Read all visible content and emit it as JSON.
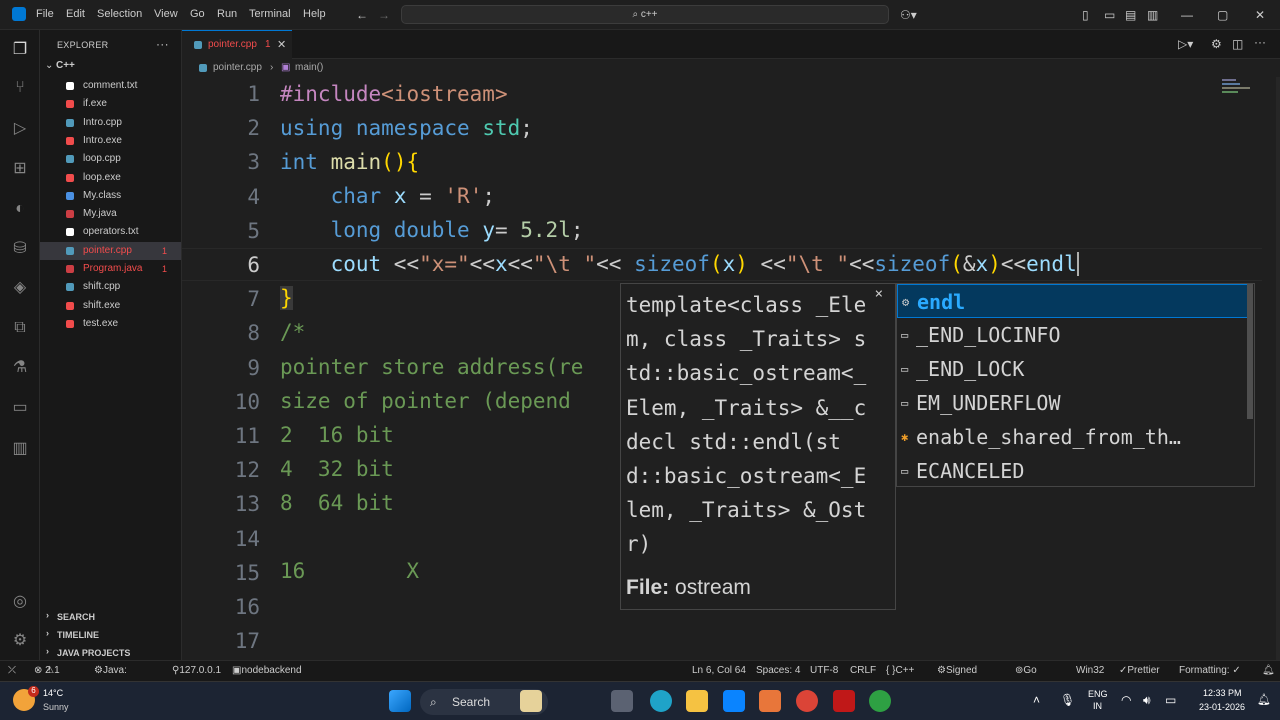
{
  "menu": [
    "File",
    "Edit",
    "Selection",
    "View",
    "Go",
    "Run",
    "Terminal",
    "Help"
  ],
  "search_placeholder": "c++",
  "sidebar": {
    "title": "EXPLORER",
    "folder": "C++",
    "files": [
      {
        "name": "comment.txt",
        "color": "#ffffff",
        "badge": ""
      },
      {
        "name": "if.exe",
        "color": "#f14c4c",
        "badge": ""
      },
      {
        "name": "Intro.cpp",
        "color": "#519aba",
        "badge": ""
      },
      {
        "name": "Intro.exe",
        "color": "#f14c4c",
        "badge": ""
      },
      {
        "name": "loop.cpp",
        "color": "#519aba",
        "badge": ""
      },
      {
        "name": "loop.exe",
        "color": "#f14c4c",
        "badge": ""
      },
      {
        "name": "My.class",
        "color": "#4a90e2",
        "badge": ""
      },
      {
        "name": "My.java",
        "color": "#cc3e44",
        "badge": ""
      },
      {
        "name": "operators.txt",
        "color": "#ffffff",
        "badge": ""
      },
      {
        "name": "pointer.cpp",
        "color": "#519aba",
        "badge": "1"
      },
      {
        "name": "Program.java",
        "color": "#cc3e44",
        "badge": "1"
      },
      {
        "name": "shift.cpp",
        "color": "#519aba",
        "badge": ""
      },
      {
        "name": "shift.exe",
        "color": "#f14c4c",
        "badge": ""
      },
      {
        "name": "test.exe",
        "color": "#f14c4c",
        "badge": ""
      }
    ],
    "sections": [
      "SEARCH",
      "TIMELINE",
      "JAVA PROJECTS"
    ]
  },
  "tab": {
    "label": "pointer.cpp",
    "badge": "1"
  },
  "breadcrumb": {
    "file": "pointer.cpp",
    "symbol": "main()"
  },
  "line_numbers": [
    "1",
    "2",
    "3",
    "4",
    "5",
    "6",
    "7",
    "8",
    "9",
    "10",
    "11",
    "12",
    "13",
    "14",
    "15",
    "16",
    "17"
  ],
  "hover": {
    "signature": "template<class _Elem, class _Traits> std::basic_ostream<_Elem, _Traits> &__cdecl std::endl(std::basic_ostream<_Elem, _Traits> &_Ostr)",
    "file_label": "File:",
    "file_value": "ostream"
  },
  "suggestions": [
    "endl",
    "_END_LOCINFO",
    "_END_LOCK",
    "EM_UNDERFLOW",
    "enable_shared_from_th…",
    "ECANCELED"
  ],
  "status": {
    "errors": "2",
    "warnings": "1",
    "java": "Java: Ready",
    "host": "127.0.0.1",
    "backend": "nodebackend",
    "position": "Ln 6, Col 64",
    "spaces": "Spaces: 4",
    "encoding": "UTF-8",
    "eol": "CRLF",
    "language": "C++",
    "account": "Signed out",
    "golive": "Go Live",
    "platform": "Win32",
    "prettier": "Prettier",
    "formatting": "Formatting: ✓"
  },
  "taskbar": {
    "weather_temp": "14°C",
    "weather_desc": "Sunny",
    "weather_badge": "6",
    "search": "Search",
    "lang1": "ENG",
    "lang2": "IN",
    "time": "12:33 PM",
    "date": "23-01-2026"
  }
}
